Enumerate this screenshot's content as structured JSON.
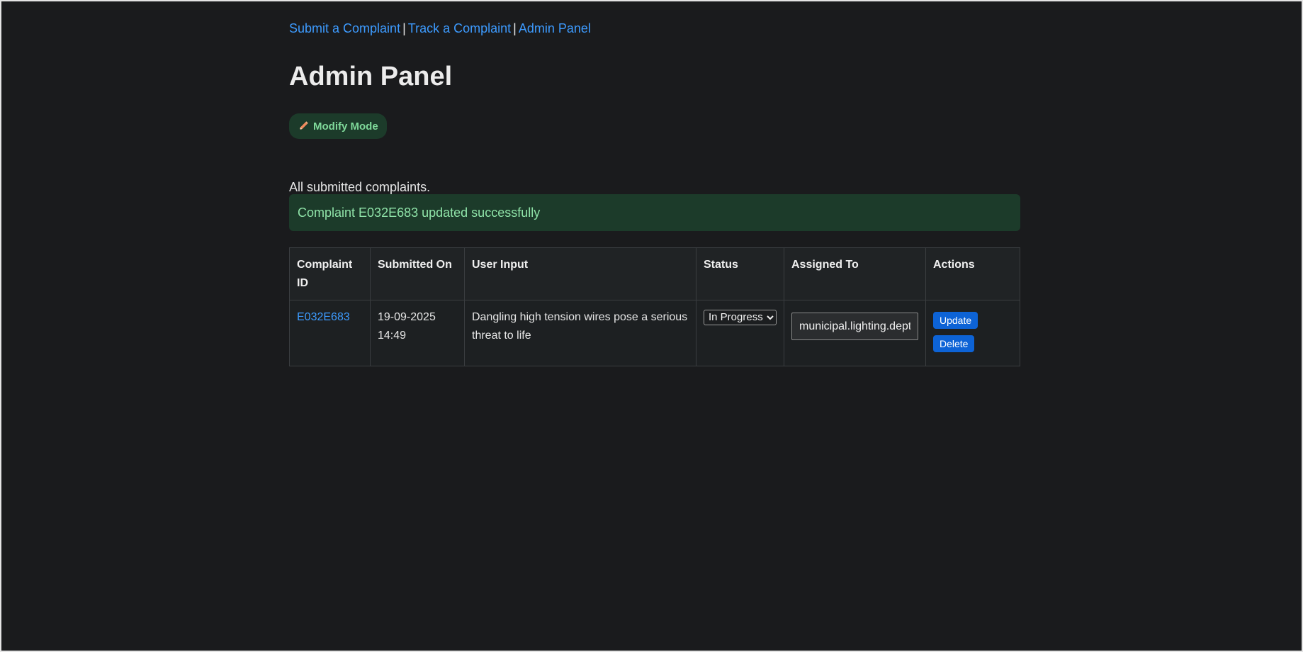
{
  "nav": {
    "links": [
      "Submit a Complaint",
      "Track a Complaint",
      "Admin Panel"
    ],
    "separator": "|"
  },
  "page": {
    "title": "Admin Panel",
    "mode_badge": "Modify Mode",
    "description": "All submitted complaints.",
    "alert": "Complaint E032E683 updated successfully"
  },
  "table": {
    "headers": [
      "Complaint ID",
      "Submitted On",
      "User Input",
      "Status",
      "Assigned To",
      "Actions"
    ],
    "rows": [
      {
        "id": "E032E683",
        "submitted_on": "19-09-2025 14:49",
        "user_input": "Dangling high tension wires pose a serious threat to life",
        "status": "In Progress",
        "assigned_to": "municipal.lighting.dept@",
        "actions": {
          "update": "Update",
          "delete": "Delete"
        }
      }
    ]
  },
  "colors": {
    "background": "#1a1b1d",
    "link": "#3d9bff",
    "success_bg": "#1c3b2a",
    "success_text": "#8fe3a8",
    "button": "#0d63d6"
  },
  "icons": {
    "mode_badge_icon": "pencil-icon"
  }
}
